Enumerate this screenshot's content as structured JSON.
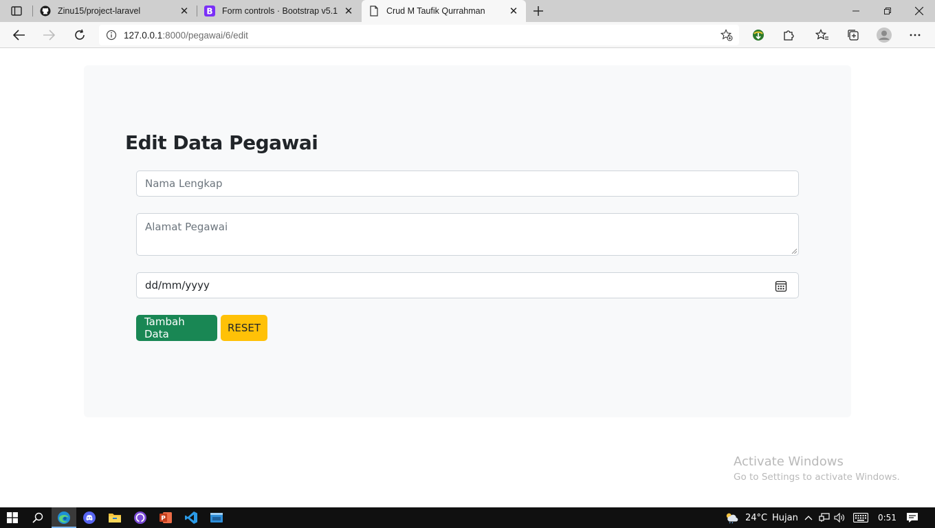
{
  "browser": {
    "tabs": [
      {
        "title": "Zinu15/project-laravel",
        "icon": "github-icon",
        "active": false
      },
      {
        "title": "Form controls · Bootstrap v5.1",
        "icon": "bootstrap-icon",
        "active": false
      },
      {
        "title": "Crud M Taufik Qurrahman",
        "icon": "page-icon",
        "active": true
      }
    ],
    "address": {
      "host": "127.0.0.1",
      "path": ":8000/pegawai/6/edit"
    }
  },
  "form": {
    "heading": "Edit Data Pegawai",
    "name_placeholder": "Nama Lengkap",
    "address_placeholder": "Alamat Pegawai",
    "date_placeholder": "dd/mm/yyyy",
    "submit_label": "Tambah Data",
    "reset_label": "RESET"
  },
  "watermark": {
    "title": "Activate Windows",
    "subtitle": "Go to Settings to activate Windows."
  },
  "taskbar": {
    "weather": "24°C",
    "weather_desc": "Hujan",
    "time": "0:51"
  },
  "colors": {
    "primary_button": "#198754",
    "reset_button": "#ffc107",
    "card_background": "#f8f9fa"
  }
}
